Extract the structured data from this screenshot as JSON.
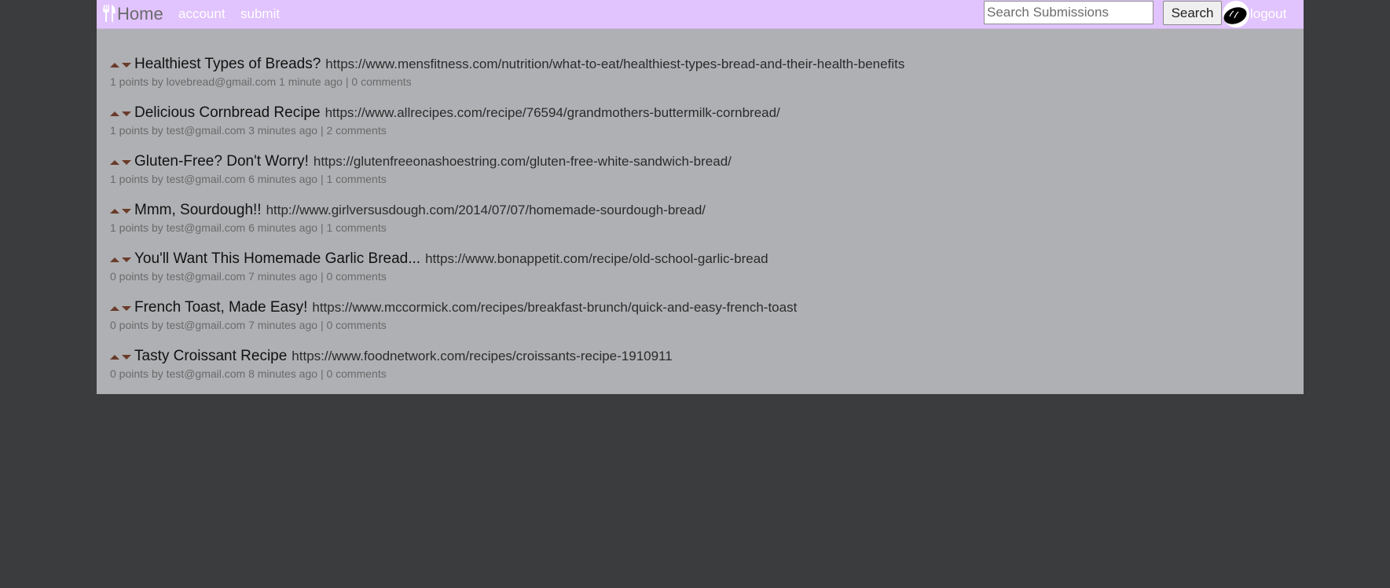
{
  "nav": {
    "home_label": "Home",
    "account_label": "account",
    "submit_label": "submit",
    "logout_label": "logout",
    "search_placeholder": "Search Submissions",
    "search_button_label": "Search"
  },
  "posts": [
    {
      "title": "Healthiest Types of Breads?",
      "url": "https://www.mensfitness.com/nutrition/what-to-eat/healthiest-types-bread-and-their-health-benefits",
      "points": "1 points",
      "by": "by",
      "author": "lovebread@gmail.com",
      "time": "1 minute ago",
      "sep": "|",
      "comments": "0 comments"
    },
    {
      "title": "Delicious Cornbread Recipe",
      "url": "https://www.allrecipes.com/recipe/76594/grandmothers-buttermilk-cornbread/",
      "points": "1 points",
      "by": "by",
      "author": "test@gmail.com",
      "time": "3 minutes ago",
      "sep": "|",
      "comments": "2 comments"
    },
    {
      "title": "Gluten-Free? Don't Worry!",
      "url": "https://glutenfreeonashoestring.com/gluten-free-white-sandwich-bread/",
      "points": "1 points",
      "by": "by",
      "author": "test@gmail.com",
      "time": "6 minutes ago",
      "sep": "|",
      "comments": "1 comments"
    },
    {
      "title": "Mmm, Sourdough!!",
      "url": "http://www.girlversusdough.com/2014/07/07/homemade-sourdough-bread/",
      "points": "1 points",
      "by": "by",
      "author": "test@gmail.com",
      "time": "6 minutes ago",
      "sep": "|",
      "comments": "1 comments"
    },
    {
      "title": "You'll Want This Homemade Garlic Bread...",
      "url": "https://www.bonappetit.com/recipe/old-school-garlic-bread",
      "points": "0 points",
      "by": "by",
      "author": "test@gmail.com",
      "time": "7 minutes ago",
      "sep": "|",
      "comments": "0 comments"
    },
    {
      "title": "French Toast, Made Easy!",
      "url": "https://www.mccormick.com/recipes/breakfast-brunch/quick-and-easy-french-toast",
      "points": "0 points",
      "by": "by",
      "author": "test@gmail.com",
      "time": "7 minutes ago",
      "sep": "|",
      "comments": "0 comments"
    },
    {
      "title": "Tasty Croissant Recipe",
      "url": "https://www.foodnetwork.com/recipes/croissants-recipe-1910911",
      "points": "0 points",
      "by": "by",
      "author": "test@gmail.com",
      "time": "8 minutes ago",
      "sep": "|",
      "comments": "0 comments"
    }
  ],
  "icons": {
    "logo": "utensils-icon",
    "avatar": "bread-icon",
    "upvote": "upvote-arrow-icon",
    "downvote": "downvote-arrow-icon"
  },
  "colors": {
    "page_background": "#3b3c3e",
    "content_background": "#afb0b3",
    "navbar_background": "#e1c3fd",
    "vote_arrow": "#6a3b2a"
  }
}
